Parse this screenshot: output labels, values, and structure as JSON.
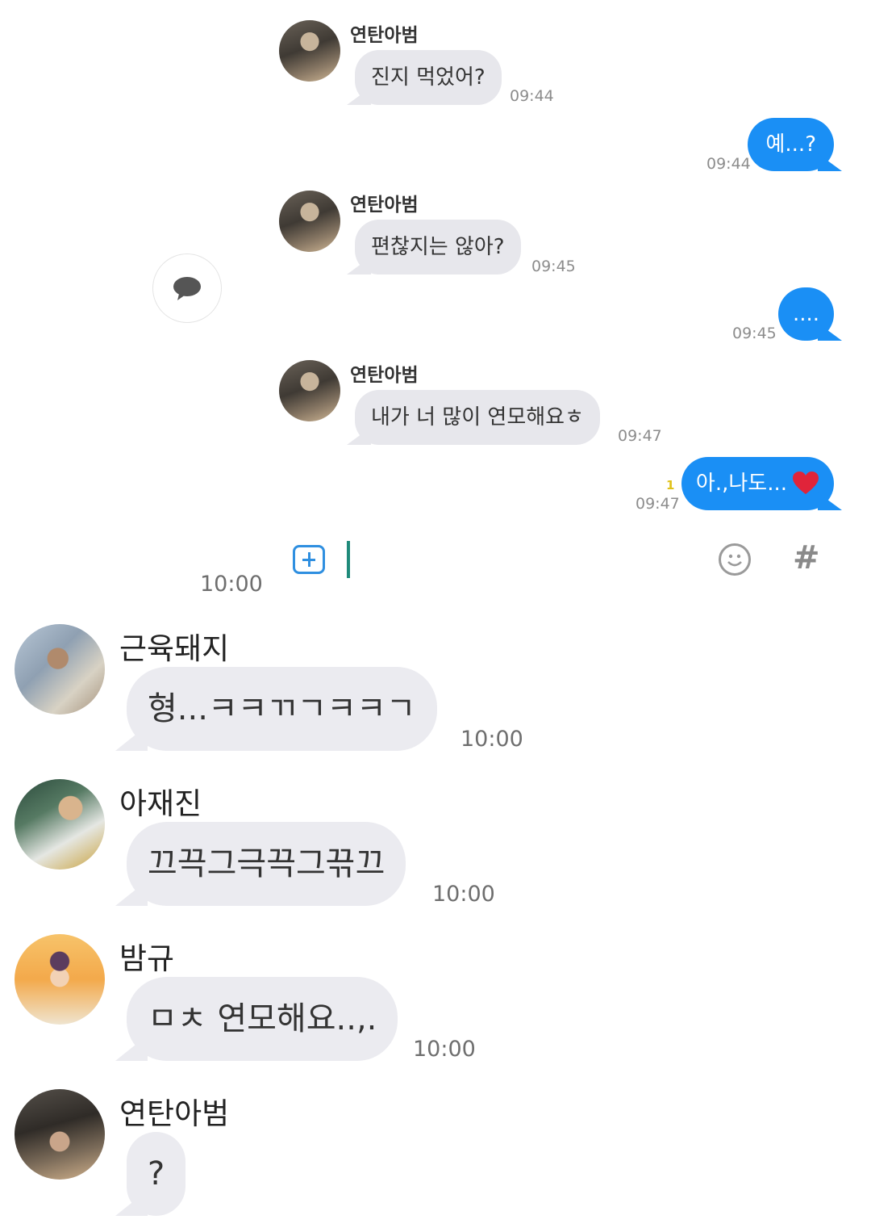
{
  "inner_chat": {
    "messages": [
      {
        "sender": "연탄아범",
        "text": "진지 먹었어?",
        "time": "09:44"
      },
      {
        "text": "예...?",
        "time": "09:44"
      },
      {
        "sender": "연탄아범",
        "text": "편찮지는 않아?",
        "time": "09:45"
      },
      {
        "text": "....",
        "time": "09:45"
      },
      {
        "sender": "연탄아범",
        "text": "내가 너 많이 연모해요ㅎ",
        "time": "09:47"
      },
      {
        "text": "아.,나도...",
        "time": "09:47",
        "unread": "1"
      }
    ],
    "outgoing_color": "#1a8ff5",
    "heart_color": "#e0243a"
  },
  "input_bar": {
    "attach_icon": "plus-box-icon",
    "emoji_icon": "smile-icon",
    "hashtag_label": "#"
  },
  "outer_chat": {
    "first_time": "10:00",
    "messages": [
      {
        "sender": "근육돼지",
        "text": "형...ㅋㅋㄲㄱㅋㅋㄱ",
        "time": "10:00"
      },
      {
        "sender": "아재진",
        "text": "끄끅그극끅그끆끄",
        "time": "10:00"
      },
      {
        "sender": "밤규",
        "text": "ㅁㅊ 연모해요..,.",
        "time": "10:00"
      },
      {
        "sender": "연탄아범",
        "text": "?"
      }
    ]
  }
}
